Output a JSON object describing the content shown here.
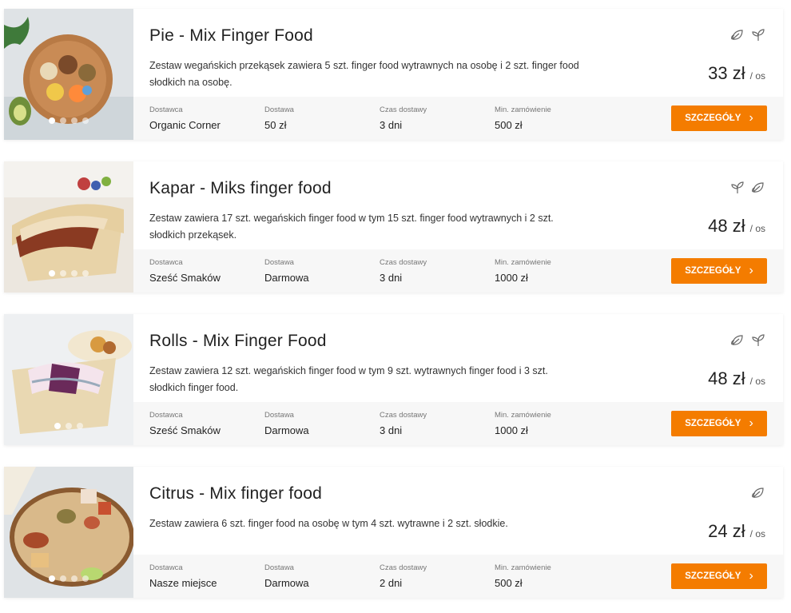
{
  "colors": {
    "accent": "#f47c00",
    "info_bg": "#f7f7f7"
  },
  "labels": {
    "supplier": "Dostawca",
    "delivery": "Dostawa",
    "delivery_time": "Czas dostawy",
    "min_order": "Min. zamówienie",
    "details_button": "SZCZEGÓŁY",
    "per_person": "/ os"
  },
  "offers": [
    {
      "title": "Pie - Mix Finger Food",
      "description": "Zestaw wegańskich przekąsek zawiera 5 szt. finger food wytrawnych na osobę i 2 szt. finger food słodkich na osobę.",
      "price": "33 zł",
      "supplier": "Organic Corner",
      "delivery": "50 zł",
      "delivery_time": "3 dni",
      "min_order": "500 zł",
      "tags": [
        "vegan-leaf-icon",
        "vegetarian-sprout-icon"
      ],
      "photo_dots": 4,
      "active_dot": 0
    },
    {
      "title": "Kapar - Miks finger food",
      "description": "Zestaw zawiera 17 szt. wegańskich finger food w tym 15 szt. finger food wytrawnych i 2 szt. słodkich przekąsek.",
      "price": "48 zł",
      "supplier": "Sześć Smaków",
      "delivery": "Darmowa",
      "delivery_time": "3 dni",
      "min_order": "1000 zł",
      "tags": [
        "vegetarian-sprout-icon",
        "vegan-leaf-icon"
      ],
      "photo_dots": 4,
      "active_dot": 0
    },
    {
      "title": "Rolls - Mix Finger Food",
      "description": "Zestaw zawiera 12 szt. wegańskich finger food w tym 9 szt. wytrawnych finger food i 3 szt. słodkich finger food.",
      "price": "48 zł",
      "supplier": "Sześć Smaków",
      "delivery": "Darmowa",
      "delivery_time": "3 dni",
      "min_order": "1000 zł",
      "tags": [
        "vegan-leaf-icon",
        "vegetarian-sprout-icon"
      ],
      "photo_dots": 3,
      "active_dot": 0
    },
    {
      "title": "Citrus - Mix finger food",
      "description": "Zestaw zawiera 6 szt. finger food na osobę w tym 4 szt. wytrawne i 2 szt. słodkie.",
      "price": "24 zł",
      "supplier": "Nasze miejsce",
      "delivery": "Darmowa",
      "delivery_time": "2 dni",
      "min_order": "500 zł",
      "tags": [
        "vegan-leaf-icon"
      ],
      "photo_dots": 4,
      "active_dot": 0
    }
  ]
}
